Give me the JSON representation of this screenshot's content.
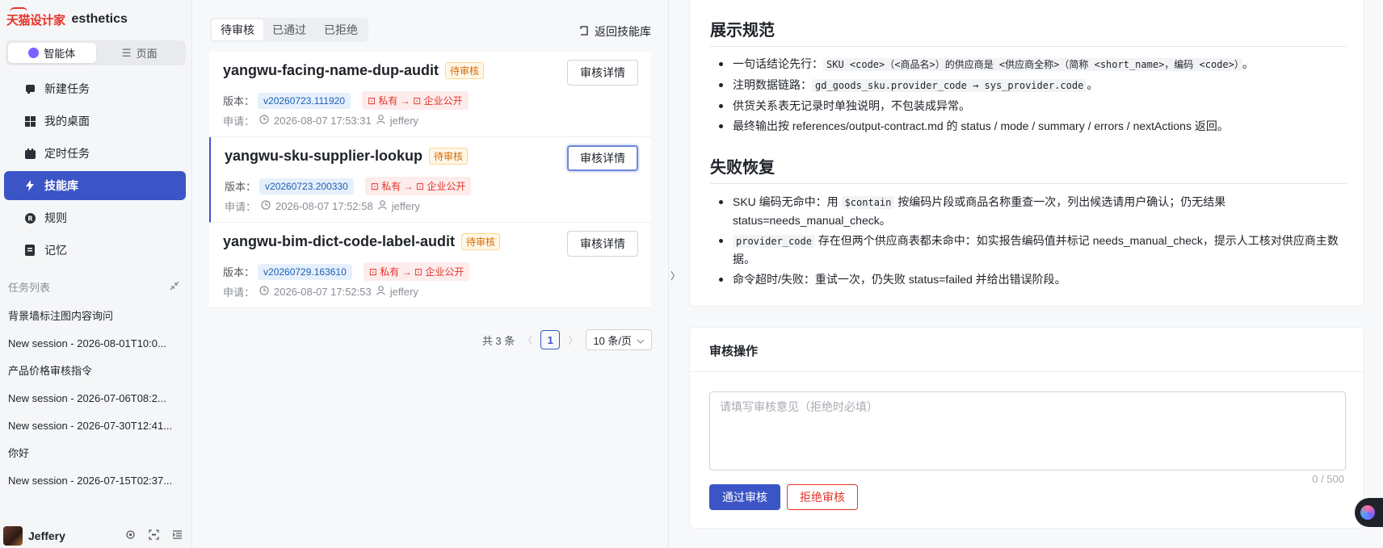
{
  "brand": {
    "logo_text": "天猫设计家",
    "name": "esthetics"
  },
  "segment": {
    "agent": "智能体",
    "pages": "页面"
  },
  "nav": [
    {
      "label": "新建任务",
      "icon": "new-task-icon"
    },
    {
      "label": "我的桌面",
      "icon": "grid-icon"
    },
    {
      "label": "定时任务",
      "icon": "calendar-icon"
    },
    {
      "label": "技能库",
      "icon": "lightning-icon",
      "active": true
    },
    {
      "label": "规则",
      "icon": "rule-icon"
    },
    {
      "label": "记忆",
      "icon": "memory-icon"
    }
  ],
  "tasks": {
    "header": "任务列表",
    "items": [
      "背景墙标注图内容询问",
      "New session - 2026-08-01T10:0...",
      "产品价格审核指令",
      "New session - 2026-07-06T08:2...",
      "New session - 2026-07-30T12:41...",
      "你好",
      "New session - 2026-07-15T02:37..."
    ]
  },
  "user": {
    "name": "Jeffery"
  },
  "review_tabs": [
    "待审核",
    "已通过",
    "已拒绝"
  ],
  "back_label": "返回技能库",
  "labels": {
    "version": "版本：",
    "apply": "申请：",
    "visibility_from": "私有",
    "arrow": "→",
    "visibility_to": "企业公开",
    "detail": "审核详情",
    "pending": "待审核"
  },
  "cards": [
    {
      "title": "yangwu-facing-name-dup-audit",
      "version": "v20260723.111920",
      "time": "2026-08-07 17:53:31",
      "user": "jeffery"
    },
    {
      "title": "yangwu-sku-supplier-lookup",
      "version": "v20260723.200330",
      "time": "2026-08-07 17:52:58",
      "user": "jeffery"
    },
    {
      "title": "yangwu-bim-dict-code-label-audit",
      "version": "v20260729.163610",
      "time": "2026-08-07 17:52:53",
      "user": "jeffery"
    }
  ],
  "pager": {
    "total": "共 3 条",
    "current": "1",
    "size": "10 条/页"
  },
  "doc": {
    "h1": "展示规范",
    "h1_items": [
      {
        "pre": "一句话结论先行：",
        "code": "SKU <code>（<商品名>）的供应商是 <供应商全称>（简称 <short_name>，编码 <code>）",
        "post": "。"
      },
      {
        "pre": "注明数据链路：",
        "code": "gd_goods_sku.provider_code → sys_provider.code",
        "post": "。"
      },
      {
        "pre": "供货关系表无记录时单独说明，不包装成异常。",
        "code": "",
        "post": ""
      },
      {
        "pre": "最终输出按 references/output-contract.md 的 status / mode / summary / errors / nextActions 返回。",
        "code": "",
        "post": ""
      }
    ],
    "h2": "失败恢复",
    "h2_items": [
      {
        "pre": "SKU 编码无命中：用 ",
        "code": "$contain",
        "post": " 按编码片段或商品名称重查一次，列出候选请用户确认；仍无结果 status=needs_manual_check。"
      },
      {
        "pre": "",
        "code": "provider_code",
        "post": " 存在但两个供应商表都未命中：如实报告编码值并标记 needs_manual_check，提示人工核对供应商主数据。"
      },
      {
        "pre": "命令超时/失败：重试一次，仍失败 status=failed 并给出错误阶段。",
        "code": "",
        "post": ""
      }
    ]
  },
  "review": {
    "title": "审核操作",
    "placeholder": "请填写审核意见（拒绝时必填）",
    "count": "0 / 500",
    "pass": "通过审核",
    "reject": "拒绝审核"
  }
}
